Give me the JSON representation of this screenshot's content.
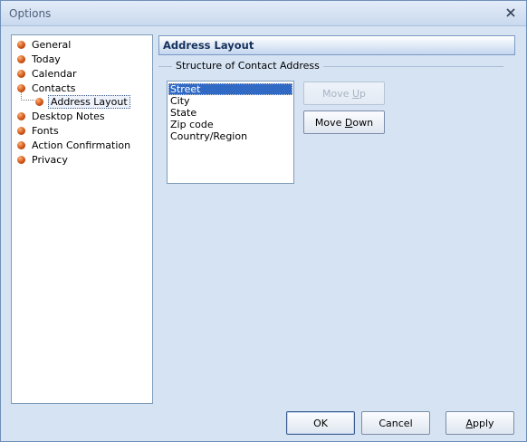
{
  "window": {
    "title": "Options"
  },
  "tree": {
    "items": [
      {
        "label": "General"
      },
      {
        "label": "Today"
      },
      {
        "label": "Calendar"
      },
      {
        "label": "Contacts"
      },
      {
        "label": "Address Layout"
      },
      {
        "label": "Desktop Notes"
      },
      {
        "label": "Fonts"
      },
      {
        "label": "Action Confirmation"
      },
      {
        "label": "Privacy"
      }
    ]
  },
  "panel": {
    "title": "Address Layout",
    "group_label": "Structure of Contact Address",
    "list": [
      "Street",
      "City",
      "State",
      "Zip code",
      "Country/Region"
    ],
    "selected": "Street",
    "move_up": {
      "pre": "Move ",
      "key": "U",
      "post": "p"
    },
    "move_down": {
      "pre": "Move ",
      "key": "D",
      "post": "own"
    }
  },
  "footer": {
    "ok": "OK",
    "cancel": "Cancel",
    "apply": {
      "key": "A",
      "post": "pply"
    }
  },
  "colors": {
    "selection": "#316ac5",
    "bullet": "#d85c1c",
    "header_text": "#15315c"
  }
}
